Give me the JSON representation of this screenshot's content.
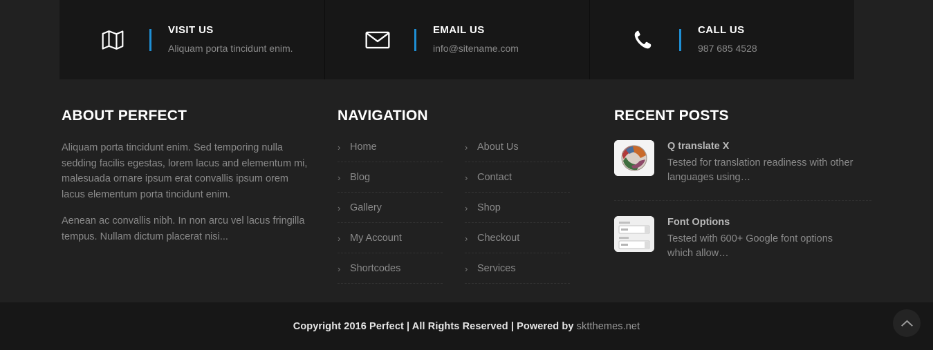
{
  "contact_bar": [
    {
      "icon": "map-icon",
      "title": "VISIT US",
      "detail": "Aliquam porta tincidunt enim."
    },
    {
      "icon": "envelope-icon",
      "title": "EMAIL US",
      "detail": "info@sitename.com"
    },
    {
      "icon": "phone-icon",
      "title": "CALL US",
      "detail": "987 685 4528"
    }
  ],
  "about": {
    "title": "ABOUT PERFECT",
    "paragraphs": [
      "Aliquam porta tincidunt enim. Sed temporing nulla sedding facilis egestas, lorem lacus and elementum mi, malesuada ornare ipsum erat convallis ipsum orem lacus elementum porta tincidunt enim.",
      "Aenean ac convallis nibh. In non arcu vel lacus fringilla tempus. Nullam dictum placerat nisi..."
    ]
  },
  "navigation": {
    "title": "NAVIGATION",
    "column_one": [
      "Home",
      "Blog",
      "Gallery",
      "My Account",
      "Shortcodes"
    ],
    "column_two": [
      "About Us",
      "Contact",
      "Shop",
      "Checkout",
      "Services"
    ]
  },
  "recent_posts": {
    "title": "RECENT POSTS",
    "items": [
      {
        "title": "Q translate X",
        "excerpt": "Tested for translation readiness with other languages using…",
        "thumb": "qtranslate-sphere-thumbnail"
      },
      {
        "title": "Font Options",
        "excerpt": "Tested with 600+ Google font options which allow…",
        "thumb": "font-options-form-thumbnail"
      }
    ]
  },
  "bottom": {
    "copyright_text": "Copyright 2016 Perfect | All Rights Reserved | Powered by ",
    "site_link": "sktthemes.net",
    "to_top_icon": "chevron-up-icon"
  },
  "colors": {
    "page_background": "#212121",
    "panel_background": "#171717",
    "accent": "#1e8fd5",
    "body_text": "#8a8a8a",
    "heading_text": "#ffffff"
  }
}
